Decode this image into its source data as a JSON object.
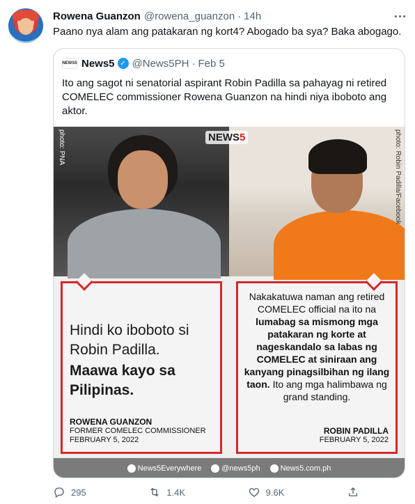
{
  "tweet": {
    "author_name": "Rowena Guanzon",
    "author_handle": "@rowena_guanzon",
    "separator": "·",
    "time": "14h",
    "text": "Paano nya alam ang patakaran ng kort4? Abogado ba sya? Baka abogago."
  },
  "quoted": {
    "logo_text": "NEWS5",
    "author_name": "News5",
    "author_handle": "@News5PH",
    "separator": "·",
    "date": "Feb 5",
    "text": "Ito ang sagot ni senatorial aspirant Robin Padilla sa pahayag ni retired COMELEC commissioner Rowena Guanzon na hindi niya iboboto ang aktor."
  },
  "graphic": {
    "photo_credit_left": "photo: PNA",
    "photo_credit_right": "photo: Robin Padilla/Facebook",
    "logo_word": "NEWS",
    "logo_num": "5",
    "left_quote_normal": "Hindi ko iboboto si Robin Padilla.",
    "left_quote_bold": "Maawa kayo sa Pilipinas.",
    "left_name": "ROWENA GUANZON",
    "left_role": "FORMER COMELEC COMMISSIONER",
    "left_date": "FEBRUARY 5, 2022",
    "right_quote_1": "Nakakatuwa naman ang retired COMELEC official na ito na",
    "right_quote_bold": "lumabag sa mismong mga patakaran ng korte at nageskandalo sa labas ng COMELEC at siniraan ang kanyang pinagsilbihan ng ilang taon.",
    "right_quote_2": "Ito ang mga halimbawa ng grand standing.",
    "right_name": "ROBIN PADILLA",
    "right_date": "FEBRUARY 5, 2022",
    "social_1": "News5Everywhere",
    "social_2": "@news5ph",
    "social_3": "News5.com.ph"
  },
  "actions": {
    "reply_count": "295",
    "retweet_count": "1.4K",
    "like_count": "9.6K"
  },
  "colors": {
    "accent_red": "#d8262a",
    "verified_blue": "#1d9bf0",
    "secondary_text": "#536471"
  },
  "icons": [
    "more-icon",
    "verified-icon",
    "reply-icon",
    "retweet-icon",
    "like-icon",
    "share-icon"
  ]
}
